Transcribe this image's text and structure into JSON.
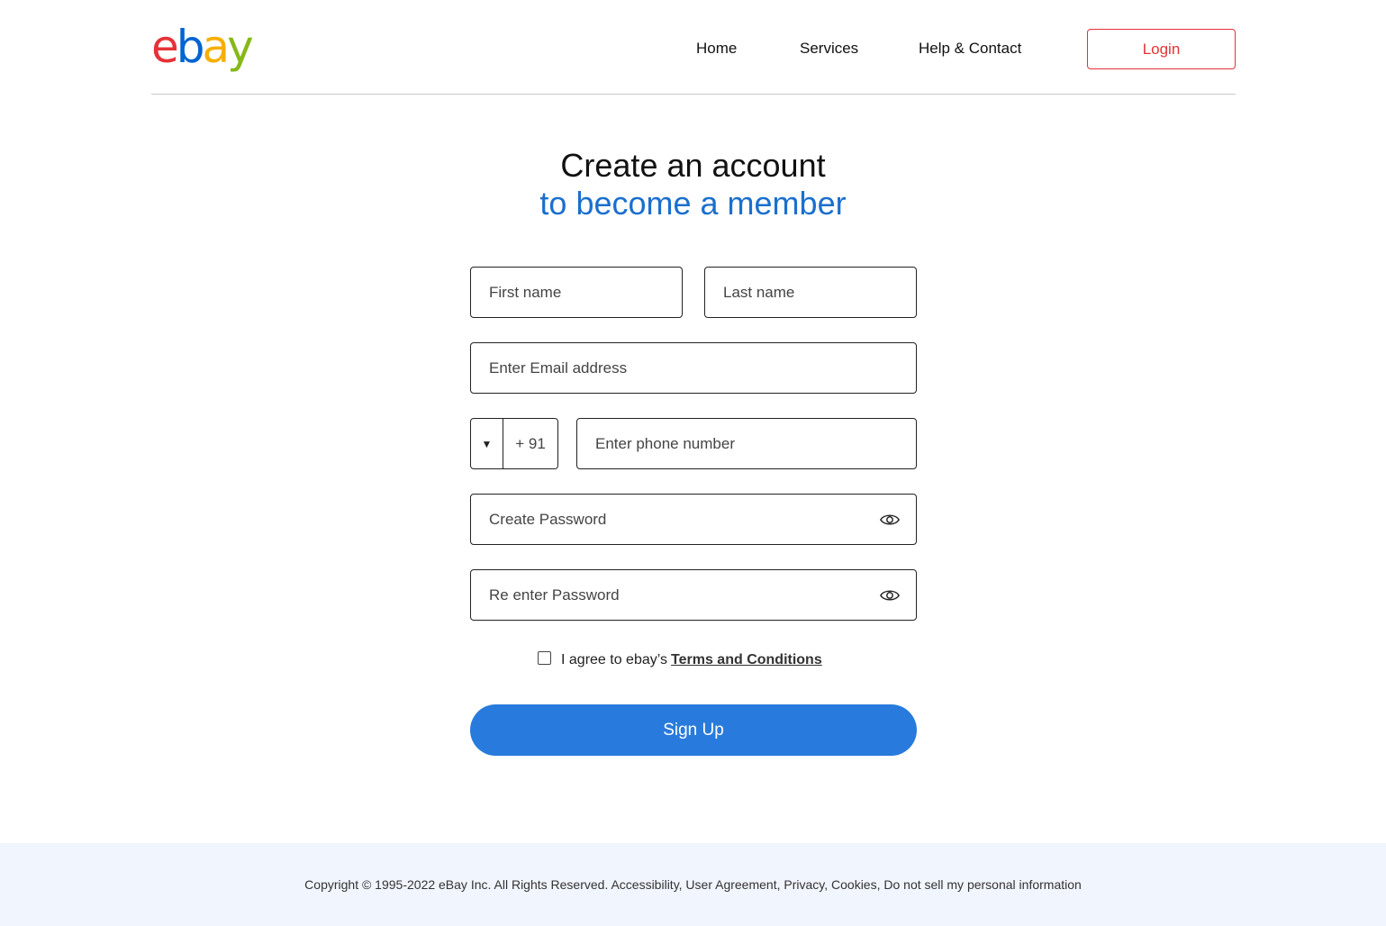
{
  "header": {
    "logo": {
      "e": "e",
      "b": "b",
      "a": "a",
      "y": "y"
    },
    "nav": {
      "home": "Home",
      "services": "Services",
      "help": "Help & Contact"
    },
    "login_label": "Login"
  },
  "main": {
    "title_line1": "Create an account",
    "title_line2": "to become a member",
    "form": {
      "first_name_placeholder": "First name",
      "last_name_placeholder": "Last name",
      "email_placeholder": "Enter Email address",
      "country_code": "+ 91",
      "phone_placeholder": "Enter phone number",
      "password_placeholder": "Create Password",
      "repassword_placeholder": "Re enter Password",
      "agree_text": "I agree to ebay’s",
      "terms_link": "Terms and Conditions",
      "signup_label": "Sign Up"
    }
  },
  "footer": {
    "copyright": "Copyright © 1995-2022 eBay Inc. All Rights Reserved. Accessibility, User Agreement, Privacy, Cookies, Do not sell my personal information"
  },
  "colors": {
    "brand_red": "#e53238",
    "brand_blue": "#0064d2",
    "brand_yellow": "#f5af02",
    "brand_green": "#86b817",
    "accent_blue": "#287bdc",
    "footer_bg": "#f1f5fd"
  },
  "icons": {
    "dropdown": "chevron-down-icon",
    "password_toggle": "eye-icon"
  }
}
